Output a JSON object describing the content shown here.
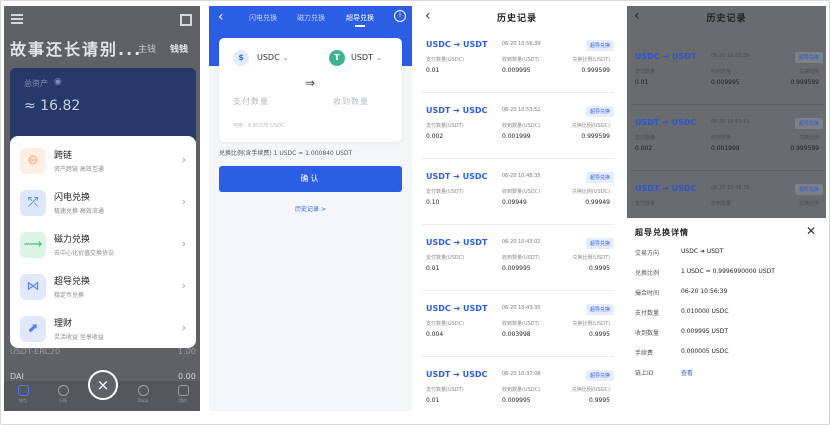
{
  "panel1": {
    "title": "故事还长请别...",
    "tabs": [
      "主钱",
      "钱钱"
    ],
    "balance_label": "总资产",
    "balance_value": "≈ 16.82",
    "menu": [
      {
        "title": "跨链",
        "sub": "资产跨链 高效互通",
        "icon": "cross-chain-icon",
        "color": "#f4a662"
      },
      {
        "title": "闪电兑换",
        "sub": "极速兑换 高效流通",
        "icon": "flash-swap-icon",
        "color": "#3b7de0"
      },
      {
        "title": "磁力兑换",
        "sub": "去中心化价值交换协议",
        "icon": "magnet-swap-icon",
        "color": "#3fc07a"
      },
      {
        "title": "超导兑换",
        "sub": "稳定币兑换",
        "icon": "superconductor-swap-icon",
        "color": "#5b7fe8"
      },
      {
        "title": "理财",
        "sub": "灵活收益 坐享收益",
        "icon": "finance-icon",
        "color": "#5b7fe8"
      }
    ],
    "rows": [
      {
        "name": "USDT-ERC20",
        "value": "1.00"
      },
      {
        "name": "DAI",
        "value": "0.00"
      }
    ],
    "nav": [
      "钱包",
      "行情",
      "",
      "Dapp",
      "我的"
    ],
    "close_icon": "×"
  },
  "panel2": {
    "tabs": [
      "闪电兑换",
      "磁力兑换",
      "超导兑换"
    ],
    "from_coin": "USDC",
    "to_coin": "USDT",
    "pay_placeholder": "支付数量",
    "receive_placeholder": "收到数量",
    "available": "可用：8.85370 USDC",
    "rate": "兑换比例(含手续费) 1 USDC ≈ 1.000840 USDT",
    "confirm_label": "确认",
    "history_link": "历史记录 >"
  },
  "panel3": {
    "title": "历史记录",
    "badge": "超导兑换",
    "pay_label": "支付数量",
    "recv_label": "收到数量",
    "rate_label": "兑换比例",
    "records": [
      {
        "pair": "USDC ➔ USDT",
        "time": "06-20 10:56:39",
        "pay_unit": "USDC",
        "recv_unit": "USDT",
        "pay": "0.01",
        "recv": "0.009995",
        "rate": "0.999599"
      },
      {
        "pair": "USDT ➔ USDC",
        "time": "06-20 10:53:51",
        "pay_unit": "USDT",
        "recv_unit": "USDC",
        "pay": "0.002",
        "recv": "0.001999",
        "rate": "0.999599"
      },
      {
        "pair": "USDT ➔ USDC",
        "time": "06-20 10:48:35",
        "pay_unit": "USDT",
        "recv_unit": "USDC",
        "pay": "0.10",
        "recv": "0.09949",
        "rate": "0.99949"
      },
      {
        "pair": "USDC ➔ USDT",
        "time": "06-20 10:43:02",
        "pay_unit": "USDC",
        "recv_unit": "USDT",
        "pay": "0.01",
        "recv": "0.009995",
        "rate": "0.9995"
      },
      {
        "pair": "USDC ➔ USDT",
        "time": "06-20 10:43:30",
        "pay_unit": "USDC",
        "recv_unit": "USDT",
        "pay": "0.004",
        "recv": "0.003998",
        "rate": "0.9995"
      },
      {
        "pair": "USDT ➔ USDC",
        "time": "06-20 10:37:08",
        "pay_unit": "USDT",
        "recv_unit": "USDC",
        "pay": "0.01",
        "recv": "0.009995",
        "rate": "0.9995"
      }
    ]
  },
  "panel4": {
    "title": "历史记录",
    "records": [
      {
        "pair": "USDC ➔ USDT",
        "time": "06-20 10:56:39",
        "pay": "0.01",
        "recv": "0.009995",
        "rate": "0.999599"
      },
      {
        "pair": "USDT ➔ USDC",
        "time": "06-20 10:53:51",
        "pay": "0.002",
        "recv": "0.001999",
        "rate": "0.999599"
      },
      {
        "pair": "USDT ➔ USDC",
        "time": "06-20 10:48:35",
        "pay": "",
        "recv": "",
        "rate": ""
      }
    ],
    "modal": {
      "title": "超导兑换详情",
      "rows": [
        {
          "k": "交易方向",
          "v": "USDC ➔ USDT"
        },
        {
          "k": "兑换比例",
          "v": "1 USDC ≈ 0.9996990000 USDT"
        },
        {
          "k": "撮合时间",
          "v": "06-20 10:56:39"
        },
        {
          "k": "支付数量",
          "v": "0.010000 USDC"
        },
        {
          "k": "收到数量",
          "v": "0.009995 USDT"
        },
        {
          "k": "手续费",
          "v": "0.000005 USDC"
        },
        {
          "k": "链上ID",
          "v": "查看"
        }
      ]
    }
  }
}
